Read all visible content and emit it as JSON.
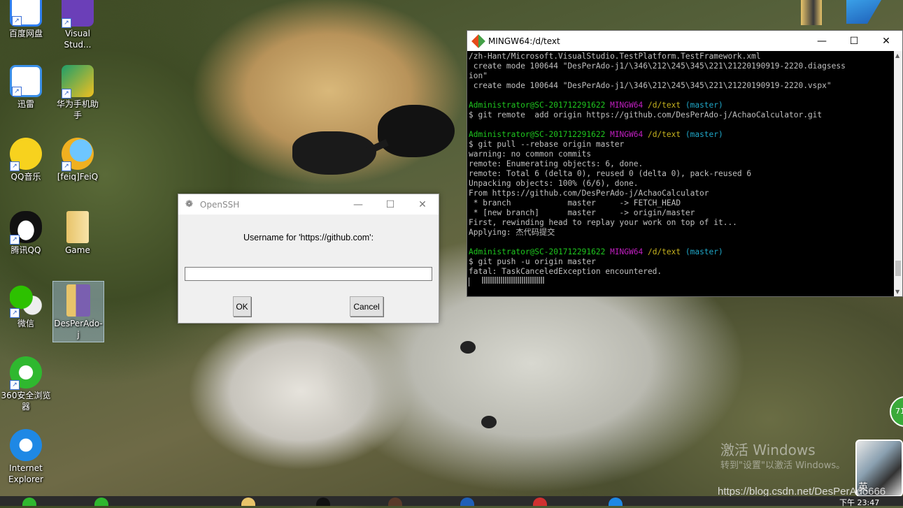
{
  "desktop": {
    "icons": [
      {
        "label": "百度网盘",
        "icon": "baidu-netdisk-icon",
        "color": "#2f7ff0"
      },
      {
        "label": "Visual\nStud...",
        "icon": "visual-studio-icon",
        "color": "#6b3fb8"
      },
      {
        "label": "迅雷",
        "icon": "xunlei-icon",
        "color": "#3a8fe8"
      },
      {
        "label": "华为手机助\n手",
        "icon": "huawei-assistant-icon",
        "color": "#1e9e6a"
      },
      {
        "label": "QQ音乐",
        "icon": "qq-music-icon",
        "color": "#f7d21e"
      },
      {
        "label": "[feiq]FeiQ",
        "icon": "feiq-icon",
        "color": "#f0b020"
      },
      {
        "label": "腾讯QQ",
        "icon": "qq-icon",
        "color": "#111111"
      },
      {
        "label": "Game",
        "icon": "folder-icon",
        "color": "#e8c46a"
      },
      {
        "label": "微信",
        "icon": "wechat-icon",
        "color": "#2dc100"
      },
      {
        "label": "DesPerAdo-\nj",
        "icon": "vs-solution-icon",
        "color": "#7a5fb0"
      },
      {
        "label": "360安全浏览\n器",
        "icon": "360-browser-icon",
        "color": "#2fb82f"
      },
      {
        "label": "Internet\nExplorer",
        "icon": "ie-icon",
        "color": "#1e88e5"
      }
    ]
  },
  "terminal": {
    "title": "MINGW64:/d/text",
    "lines": [
      [
        {
          "t": "/zh-Hant/Microsoft.VisualStudio.TestPlatform.TestFramework.xml",
          "c": ""
        }
      ],
      [
        {
          "t": " create mode 100644 \"DesPerAdo-j1/\\346\\212\\245\\345\\221\\21220190919-2220.diagsess",
          "c": ""
        }
      ],
      [
        {
          "t": "ion\"",
          "c": ""
        }
      ],
      [
        {
          "t": " create mode 100644 \"DesPerAdo-j1/\\346\\212\\245\\345\\221\\21220190919-2220.vspx\"",
          "c": ""
        }
      ],
      [
        {
          "t": "",
          "c": ""
        }
      ],
      [
        {
          "t": "Administrator@SC-201712291622 ",
          "c": "c-green"
        },
        {
          "t": "MINGW64 ",
          "c": "c-mag"
        },
        {
          "t": "/d/text ",
          "c": "c-yel"
        },
        {
          "t": "(master)",
          "c": "c-cyan"
        }
      ],
      [
        {
          "t": "$ git remote  add origin https://github.com/DesPerAdo-j/AchaoCalculator.git",
          "c": ""
        }
      ],
      [
        {
          "t": "",
          "c": ""
        }
      ],
      [
        {
          "t": "Administrator@SC-201712291622 ",
          "c": "c-green"
        },
        {
          "t": "MINGW64 ",
          "c": "c-mag"
        },
        {
          "t": "/d/text ",
          "c": "c-yel"
        },
        {
          "t": "(master)",
          "c": "c-cyan"
        }
      ],
      [
        {
          "t": "$ git pull --rebase origin master",
          "c": ""
        }
      ],
      [
        {
          "t": "warning: no common commits",
          "c": ""
        }
      ],
      [
        {
          "t": "remote: Enumerating objects: 6, done.",
          "c": ""
        }
      ],
      [
        {
          "t": "remote: Total 6 (delta 0), reused 0 (delta 0), pack-reused 6",
          "c": ""
        }
      ],
      [
        {
          "t": "Unpacking objects: 100% (6/6), done.",
          "c": ""
        }
      ],
      [
        {
          "t": "From https://github.com/DesPerAdo-j/AchaoCalculator",
          "c": ""
        }
      ],
      [
        {
          "t": " * branch            master     -> FETCH_HEAD",
          "c": ""
        }
      ],
      [
        {
          "t": " * [new branch]      master     -> origin/master",
          "c": ""
        }
      ],
      [
        {
          "t": "First, rewinding head to replay your work on top of it...",
          "c": ""
        }
      ],
      [
        {
          "t": "Applying: 杰代码提交",
          "c": ""
        }
      ],
      [
        {
          "t": "",
          "c": ""
        }
      ],
      [
        {
          "t": "Administrator@SC-201712291622 ",
          "c": "c-green"
        },
        {
          "t": "MINGW64 ",
          "c": "c-mag"
        },
        {
          "t": "/d/text ",
          "c": "c-yel"
        },
        {
          "t": "(master)",
          "c": "c-cyan"
        }
      ],
      [
        {
          "t": "$ git push -u origin master",
          "c": ""
        }
      ],
      [
        {
          "t": "fatal: TaskCanceledException encountered.",
          "c": ""
        }
      ]
    ]
  },
  "dialog": {
    "title": "OpenSSH",
    "prompt": "Username for 'https://github.com':",
    "input_value": "",
    "ok_label": "OK",
    "cancel_label": "Cancel"
  },
  "watermark": {
    "line1": "激活 Windows",
    "line2": "转到\"设置\"以激活 Windows。"
  },
  "blog_url": "https://blog.csdn.net/DesPerAdo666",
  "tray": {
    "badge": "71",
    "ime": "英",
    "time": "下午 23:47"
  }
}
